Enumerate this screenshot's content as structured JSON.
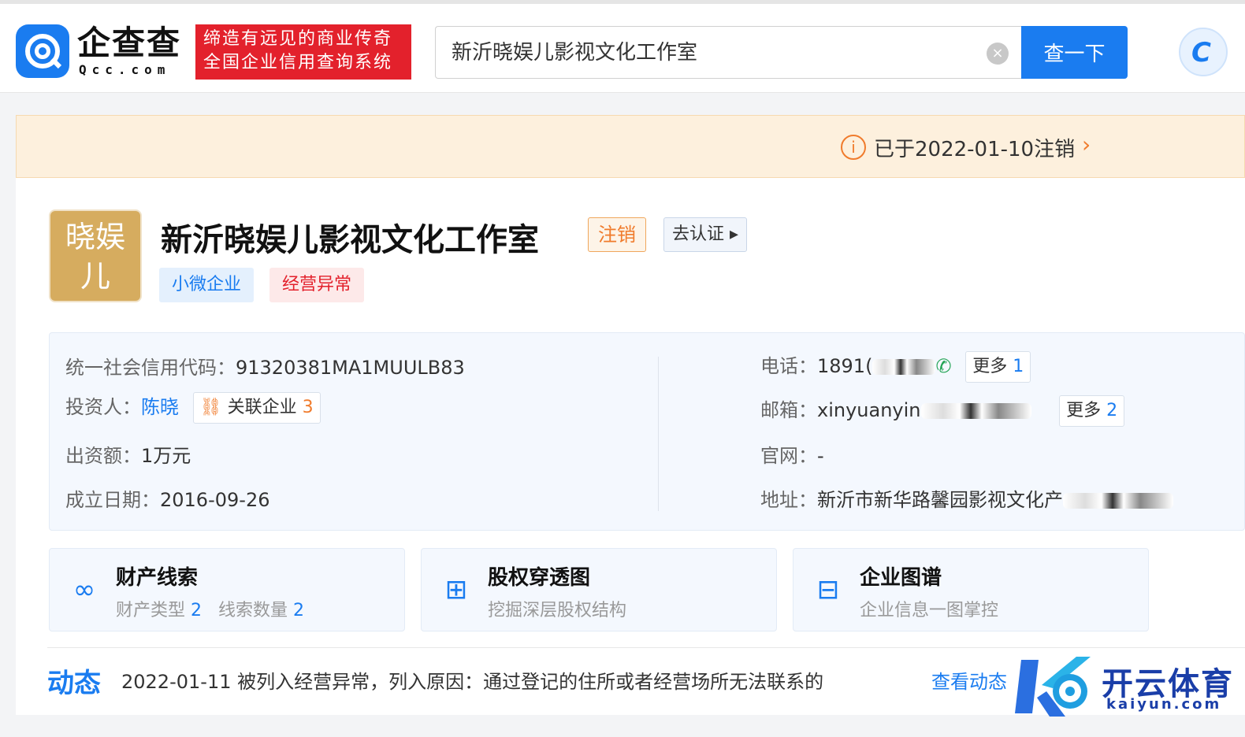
{
  "header": {
    "logo_text": "企查查",
    "logo_sub": "Qcc.com",
    "slogan_line1": "缔造有远见的商业传奇",
    "slogan_line2": "全国企业信用查询系统",
    "search_value": "新沂晓娱儿影视文化工作室",
    "search_button": "查一下",
    "clear_icon": "×",
    "app_icon_glyph": "C"
  },
  "notice": {
    "text": "已于2022-01-10注销",
    "icon": "i",
    "chevron": "›"
  },
  "company": {
    "avatar_line1": "晓娱",
    "avatar_line2": "儿",
    "name": "新沂晓娱儿影视文化工作室",
    "status": "注销",
    "certify": "去认证 ▸",
    "tags": [
      "小微企业",
      "经营异常"
    ]
  },
  "info": {
    "credit_label": "统一社会信用代码：",
    "credit_value": "91320381MA1MUULB83",
    "investor_label": "投资人：",
    "investor_value": "陈晓",
    "related_label": "关联企业",
    "related_count": "3",
    "capital_label": "出资额：",
    "capital_value": "1万元",
    "founded_label": "成立日期：",
    "founded_value": "2016-09-26",
    "phone_label": "电话：",
    "phone_value": "1891(",
    "phone_more": "更多",
    "phone_more_count": "1",
    "email_label": "邮箱：",
    "email_value": "xinyuanyin",
    "email_more": "更多",
    "email_more_count": "2",
    "website_label": "官网：",
    "website_value": "-",
    "address_label": "地址：",
    "address_value": "新沂市新华路馨园影视文化产"
  },
  "features": [
    {
      "title": "财产线索",
      "sub_a": "财产类型",
      "sub_a_count": "2",
      "sub_b": "线索数量",
      "sub_b_count": "2",
      "icon": "link-icon"
    },
    {
      "title": "股权穿透图",
      "sub": "挖掘深层股权结构",
      "icon": "org-chart-icon"
    },
    {
      "title": "企业图谱",
      "sub": "企业信息一图掌控",
      "icon": "graph-icon"
    }
  ],
  "dynamics": {
    "title": "动态",
    "text": "2022-01-11 被列入经营异常，列入原因：通过登记的住所或者经营场所无法联系的",
    "link": "查看动态"
  },
  "watermark": {
    "text": "开云体育",
    "sub": "kaiyun.com"
  },
  "colors": {
    "brand_blue": "#1a7cf0",
    "slogan_red": "#e3212c",
    "warning_orange": "#f07b2c"
  }
}
